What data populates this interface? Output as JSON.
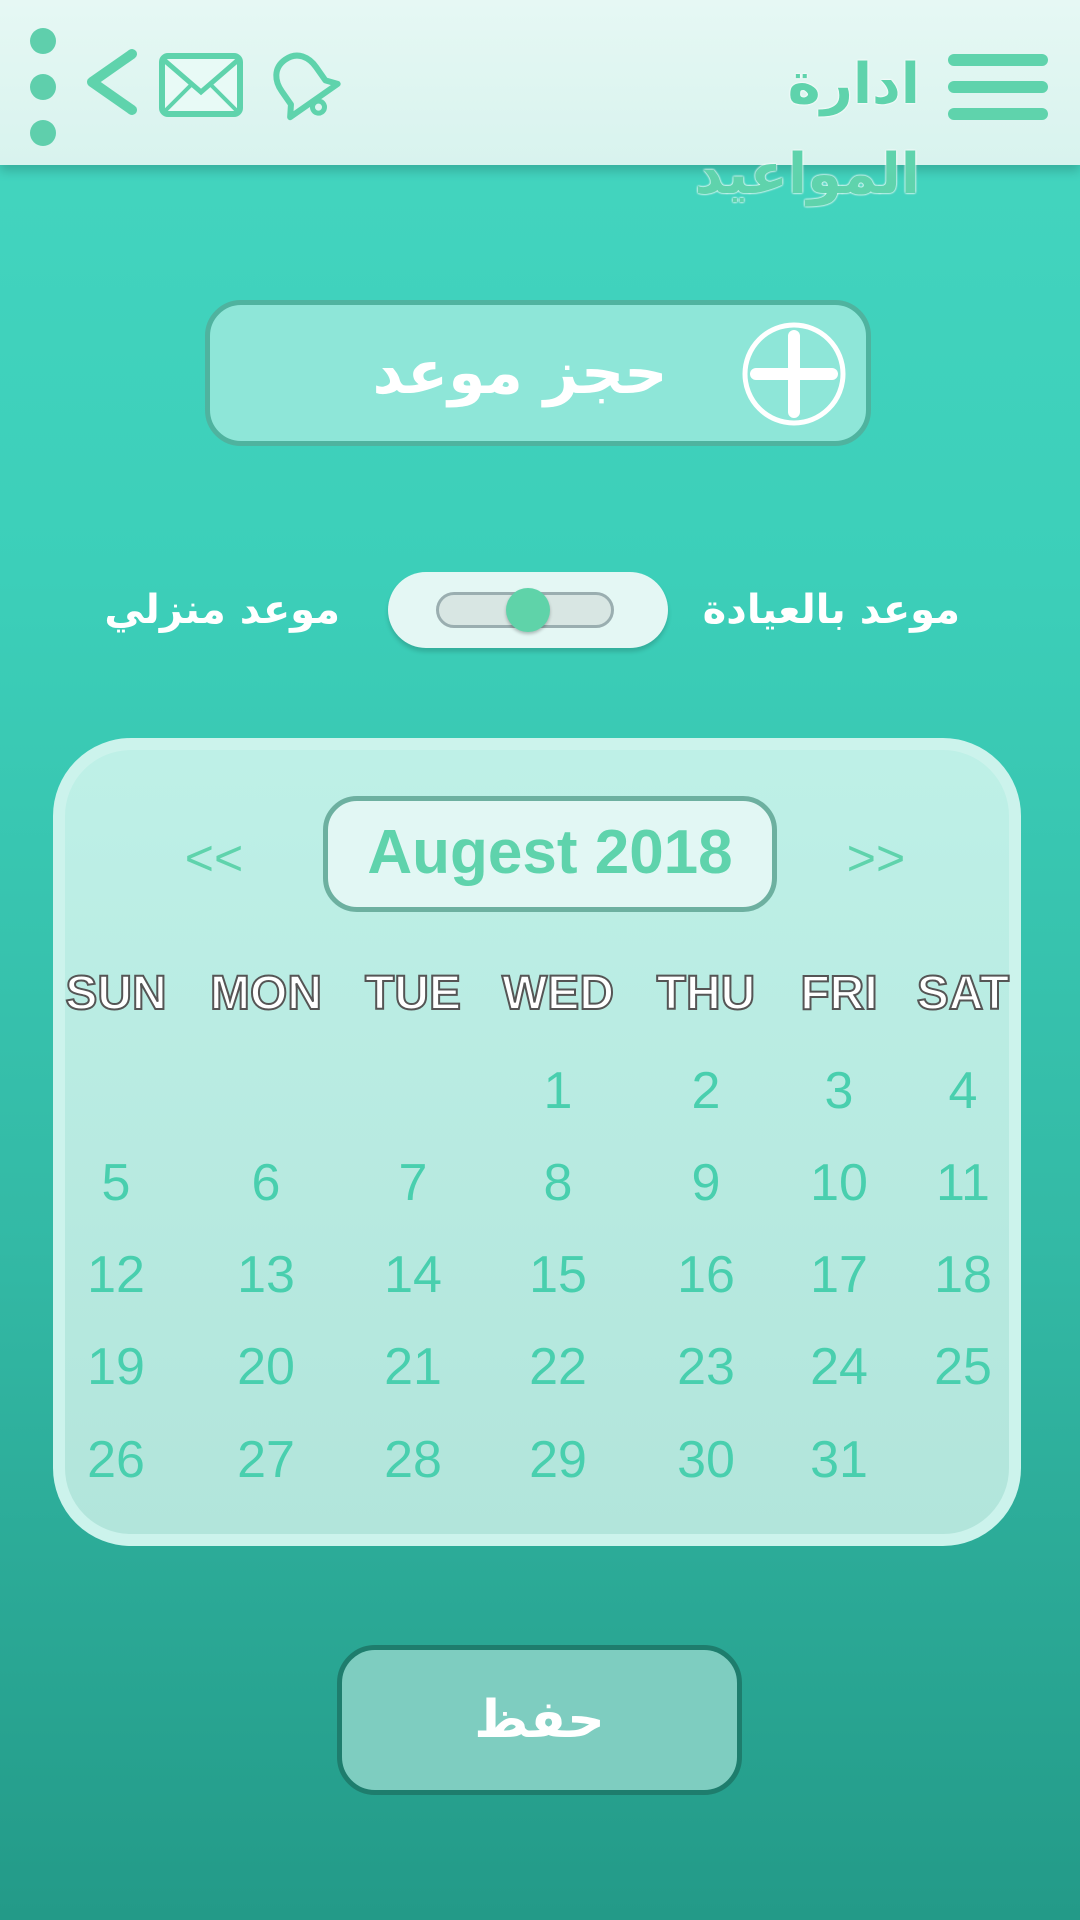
{
  "header": {
    "title": "ادارة المواعيد",
    "icons": [
      "more-vert-icon",
      "back-arrow-icon",
      "mail-icon",
      "bell-icon",
      "hamburger-menu-icon"
    ]
  },
  "booking": {
    "label": "حجز موعد",
    "icon": "plus-circle-icon"
  },
  "toggle": {
    "left_label": "موعد منزلي",
    "right_label": "موعد بالعيادة"
  },
  "calendar": {
    "prev": "<<",
    "next": ">>",
    "month": "Augest 2018",
    "weekdays": [
      "SUN",
      "MON",
      "TUE",
      "WED",
      "THU",
      "FRI",
      "SAT"
    ],
    "weeks": [
      [
        "",
        "",
        "",
        "1",
        "2",
        "3",
        "4"
      ],
      [
        "5",
        "6",
        "7",
        "8",
        "9",
        "10",
        "11"
      ],
      [
        "12",
        "13",
        "14",
        "15",
        "16",
        "17",
        "18"
      ],
      [
        "19",
        "20",
        "21",
        "22",
        "23",
        "24",
        "25"
      ],
      [
        "26",
        "27",
        "28",
        "29",
        "30",
        "31",
        ""
      ]
    ]
  },
  "save": {
    "label": "حفظ"
  },
  "colors": {
    "accent": "#5fd3ac",
    "background_top": "#45d6c1",
    "background_bottom": "#239a88",
    "header_bg": "#e6f8f4"
  }
}
